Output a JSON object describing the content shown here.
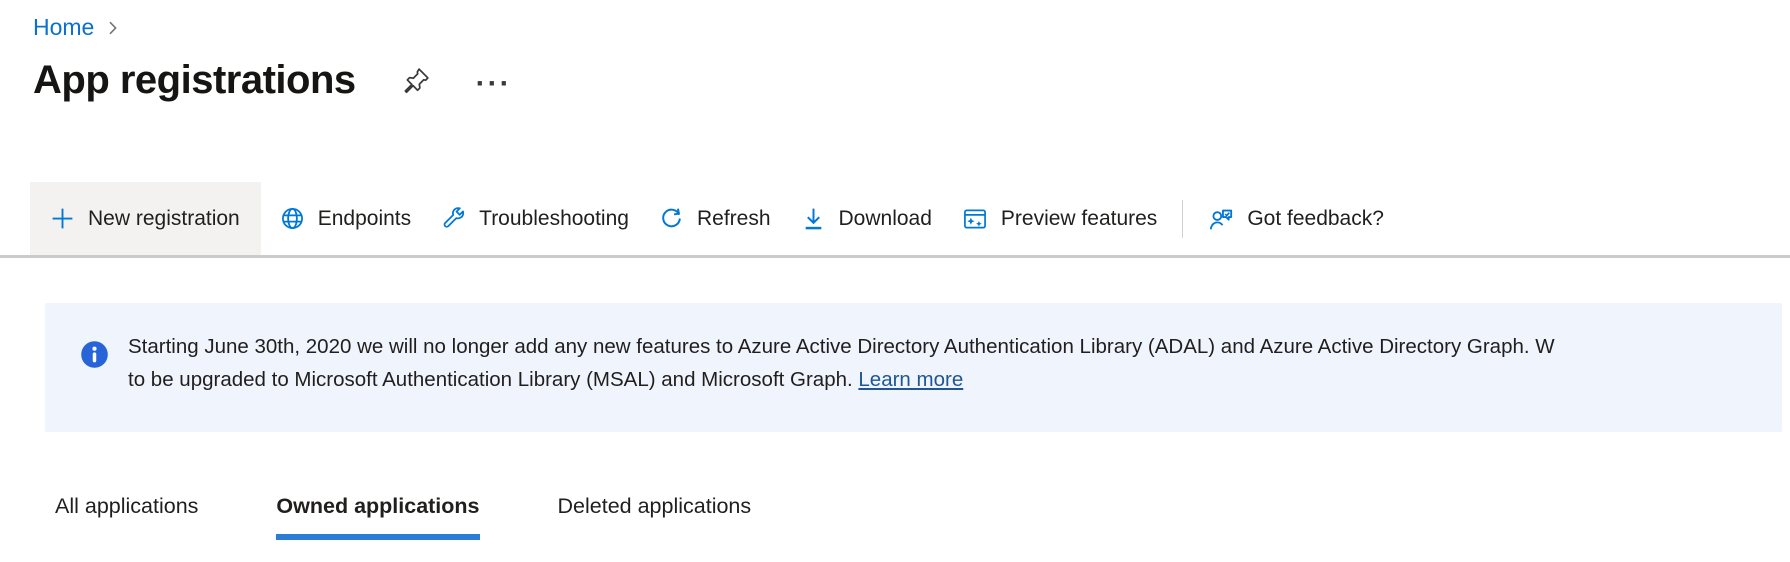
{
  "breadcrumb": {
    "items": [
      {
        "label": "Home"
      }
    ]
  },
  "header": {
    "title": "App registrations",
    "more_dots": "···"
  },
  "toolbar": {
    "items": [
      {
        "label": "New registration",
        "icon": "plus-icon"
      },
      {
        "label": "Endpoints",
        "icon": "globe-icon"
      },
      {
        "label": "Troubleshooting",
        "icon": "wrench-icon"
      },
      {
        "label": "Refresh",
        "icon": "refresh-icon"
      },
      {
        "label": "Download",
        "icon": "download-icon"
      },
      {
        "label": "Preview features",
        "icon": "preview-features-icon"
      },
      {
        "label": "Got feedback?",
        "icon": "feedback-icon"
      }
    ]
  },
  "banner": {
    "line1": "Starting June 30th, 2020 we will no longer add any new features to Azure Active Directory Authentication Library (ADAL) and Azure Active Directory Graph. W",
    "line2_prefix": "to be upgraded to Microsoft Authentication Library (MSAL) and Microsoft Graph. ",
    "learn_more_label": "Learn more"
  },
  "tabs": [
    {
      "label": "All applications",
      "selected": false
    },
    {
      "label": "Owned applications",
      "selected": true
    },
    {
      "label": "Deleted applications",
      "selected": false
    }
  ],
  "colors": {
    "accent_blue": "#0078d4",
    "breadcrumb_link": "#0b71d0",
    "info_icon_blue": "#2764d8",
    "banner_background": "#f0f4fc",
    "learn_more_link": "#1f5693",
    "tab_underline": "#2b7cd4",
    "toolbar_button_background": "#f3f2f1",
    "divider_gray": "#cccbca",
    "text_dark": "#201f1e"
  }
}
